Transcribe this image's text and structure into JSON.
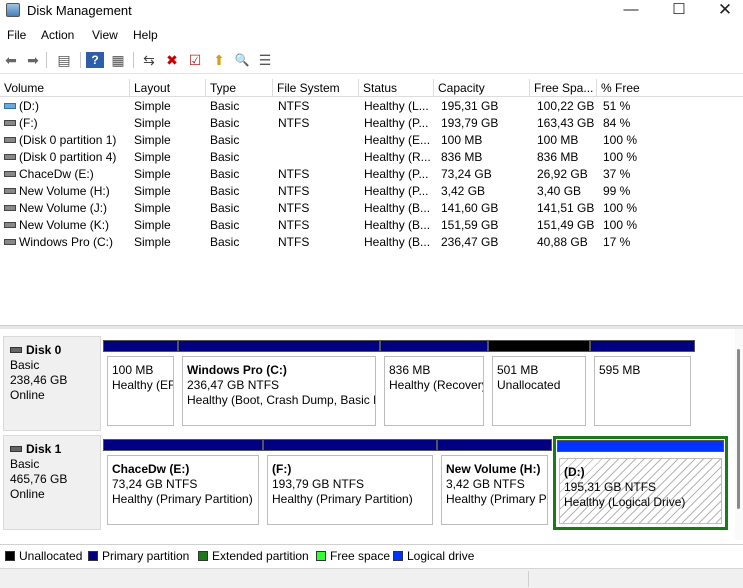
{
  "window": {
    "title": "Disk Management",
    "minimize_glyph": "—",
    "maximize_glyph": "☐",
    "close_glyph": "✕"
  },
  "menu": [
    {
      "label": "File"
    },
    {
      "label": "Action"
    },
    {
      "label": "View"
    },
    {
      "label": "Help"
    }
  ],
  "toolbar": {
    "back_glyph": "⬅",
    "forward_glyph": "➡",
    "console_tree_glyph": "▤",
    "help_glyph": "?",
    "properties_glyph": "▦",
    "connect_glyph": "⇆",
    "delete_glyph": "✖",
    "check_glyph": "☑",
    "up_glyph": "⬆",
    "search_glyph": "🔍",
    "list_glyph": "☰"
  },
  "list": {
    "columns": [
      {
        "label": "Volume"
      },
      {
        "label": "Layout"
      },
      {
        "label": "Type"
      },
      {
        "label": "File System"
      },
      {
        "label": "Status"
      },
      {
        "label": "Capacity"
      },
      {
        "label": "Free Spa..."
      },
      {
        "label": "% Free"
      }
    ],
    "rows": [
      {
        "volume": "(D:)",
        "layout": "Simple",
        "type": "Basic",
        "fs": "NTFS",
        "status": "Healthy (L...",
        "capacity": "195,31 GB",
        "free": "100,22 GB",
        "pct": "51 %"
      },
      {
        "volume": "(F:)",
        "layout": "Simple",
        "type": "Basic",
        "fs": "NTFS",
        "status": "Healthy (P...",
        "capacity": "193,79 GB",
        "free": "163,43 GB",
        "pct": "84 %"
      },
      {
        "volume": "(Disk 0 partition 1)",
        "layout": "Simple",
        "type": "Basic",
        "fs": "",
        "status": "Healthy (E...",
        "capacity": "100 MB",
        "free": "100 MB",
        "pct": "100 %"
      },
      {
        "volume": "(Disk 0 partition 4)",
        "layout": "Simple",
        "type": "Basic",
        "fs": "",
        "status": "Healthy (R...",
        "capacity": "836 MB",
        "free": "836 MB",
        "pct": "100 %"
      },
      {
        "volume": "ChaceDw (E:)",
        "layout": "Simple",
        "type": "Basic",
        "fs": "NTFS",
        "status": "Healthy (P...",
        "capacity": "73,24 GB",
        "free": "26,92 GB",
        "pct": "37 %"
      },
      {
        "volume": "New Volume (H:)",
        "layout": "Simple",
        "type": "Basic",
        "fs": "NTFS",
        "status": "Healthy (P...",
        "capacity": "3,42 GB",
        "free": "3,40 GB",
        "pct": "99 %"
      },
      {
        "volume": "New Volume (J:)",
        "layout": "Simple",
        "type": "Basic",
        "fs": "NTFS",
        "status": "Healthy (B...",
        "capacity": "141,60 GB",
        "free": "141,51 GB",
        "pct": "100 %"
      },
      {
        "volume": "New Volume (K:)",
        "layout": "Simple",
        "type": "Basic",
        "fs": "NTFS",
        "status": "Healthy (B...",
        "capacity": "151,59 GB",
        "free": "151,49 GB",
        "pct": "100 %"
      },
      {
        "volume": "Windows Pro  (C:)",
        "layout": "Simple",
        "type": "Basic",
        "fs": "NTFS",
        "status": "Healthy (B...",
        "capacity": "236,47 GB",
        "free": "40,88 GB",
        "pct": "17 %"
      }
    ]
  },
  "disks": [
    {
      "name": "Disk 0",
      "type": "Basic",
      "size": "238,46 GB",
      "state": "Online",
      "partitions": [
        {
          "name": "",
          "line1": "100 MB",
          "line2": "Healthy (EF"
        },
        {
          "name": "Windows Pro  (C:)",
          "line1": "236,47 GB NTFS",
          "line2": "Healthy (Boot, Crash Dump, Basic D"
        },
        {
          "name": "",
          "line1": "836 MB",
          "line2": "Healthy (Recovery"
        },
        {
          "name": "",
          "line1": "501 MB",
          "line2": "Unallocated"
        },
        {
          "name": "",
          "line1": "595 MB",
          "line2": ""
        }
      ]
    },
    {
      "name": "Disk 1",
      "type": "Basic",
      "size": "465,76 GB",
      "state": "Online",
      "partitions": [
        {
          "name": "ChaceDw  (E:)",
          "line1": "73,24 GB NTFS",
          "line2": "Healthy (Primary Partition)"
        },
        {
          "name": "(F:)",
          "line1": "193,79 GB NTFS",
          "line2": "Healthy (Primary Partition)"
        },
        {
          "name": "New Volume  (H:)",
          "line1": "3,42 GB NTFS",
          "line2": "Healthy (Primary P"
        },
        {
          "name": "(D:)",
          "line1": "195,31 GB NTFS",
          "line2": "Healthy (Logical Drive)"
        }
      ]
    }
  ],
  "legend": [
    {
      "label": "Unallocated",
      "color": "#000000"
    },
    {
      "label": "Primary partition",
      "color": "#000080"
    },
    {
      "label": "Extended partition",
      "color": "#1a7a1a"
    },
    {
      "label": "Free space",
      "color": "#33ff33"
    },
    {
      "label": "Logical drive",
      "color": "#0033ff"
    }
  ]
}
